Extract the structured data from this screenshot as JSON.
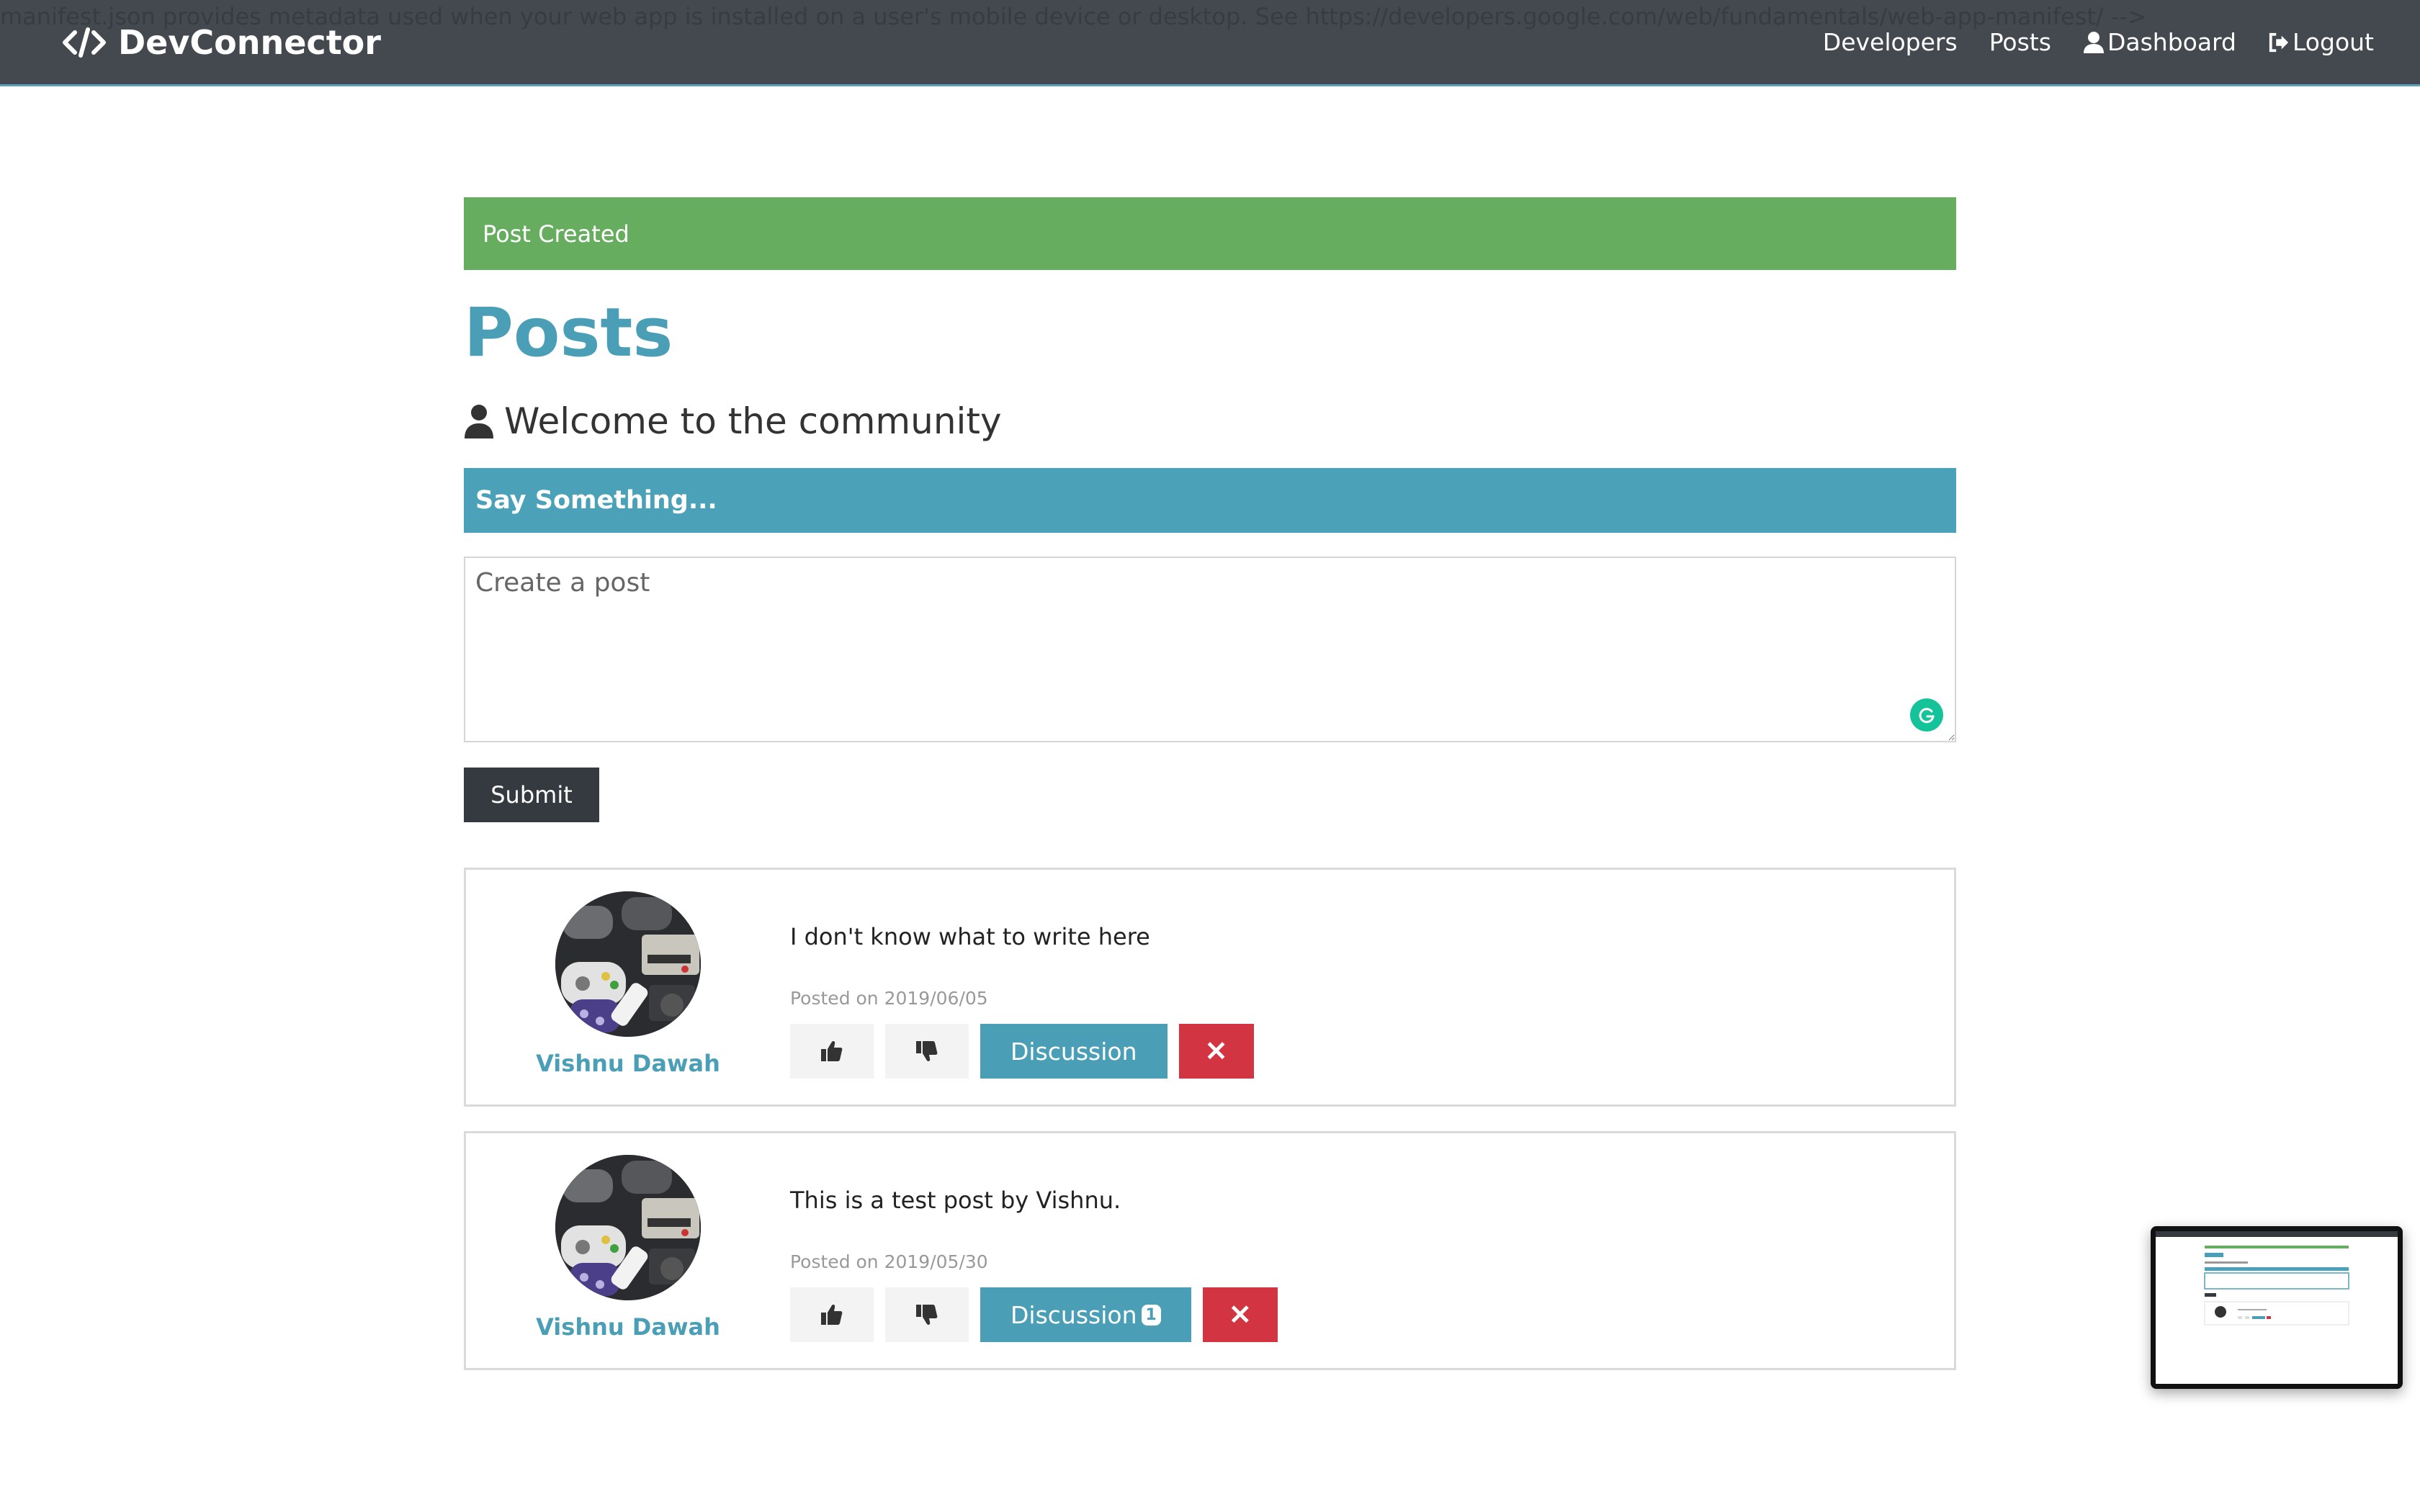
{
  "overlay_comment": "manifest.json provides metadata used when your web app is installed on a user's mobile device or desktop. See https://developers.google.com/web/fundamentals/web-app-manifest/ -->",
  "navbar": {
    "brand": "DevConnector",
    "links": [
      {
        "label": "Developers",
        "icon": null
      },
      {
        "label": "Posts",
        "icon": null
      },
      {
        "label": "Dashboard",
        "icon": "user-icon"
      },
      {
        "label": "Logout",
        "icon": "sign-out-icon"
      }
    ]
  },
  "alert": {
    "text": "Post Created",
    "color": "#67ad5f"
  },
  "page": {
    "title": "Posts",
    "lead": "Welcome to the community"
  },
  "post_form": {
    "header": "Say Something...",
    "placeholder": "Create a post",
    "value": "",
    "submit_label": "Submit"
  },
  "posts": [
    {
      "author": "Vishnu Dawah",
      "text": "I don't know what to write here",
      "date": "Posted on 2019/06/05",
      "discussion_label": "Discussion",
      "comment_count": null,
      "delete_label": "✕"
    },
    {
      "author": "Vishnu Dawah",
      "text": "This is a test post by Vishnu.",
      "date": "Posted on 2019/05/30",
      "discussion_label": "Discussion",
      "comment_count": "1",
      "delete_label": "✕"
    }
  ],
  "colors": {
    "primary": "#4a9fb6",
    "dark": "#343a40",
    "success": "#67ad5f",
    "danger": "#d23442",
    "light": "#f3f3f3"
  }
}
